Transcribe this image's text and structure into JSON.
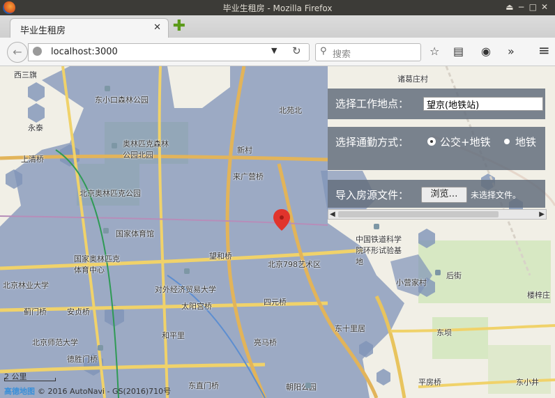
{
  "window": {
    "title": "毕业生租房 - Mozilla Firefox",
    "controls": [
      "⏏",
      "−",
      "□",
      "✕"
    ]
  },
  "tab": {
    "title": "毕业生租房",
    "close": "✕",
    "new_tab": "✚"
  },
  "nav": {
    "url": "localhost:3000",
    "search_placeholder": "搜索",
    "overflow": "»",
    "menu": "≡"
  },
  "panel": {
    "work_label": "选择工作地点：",
    "work_value": "望京(地铁站)",
    "commute_label": "选择通勤方式：",
    "option_bus_subway": "公交+地铁",
    "option_subway": "地铁",
    "selected_option": "公交+地铁",
    "import_label": "导入房源文件：",
    "browse_button": "浏览…",
    "no_file": "未选择文件。"
  },
  "map": {
    "labels": [
      {
        "text": "西三旗"
      },
      {
        "text": "东小口森林公园"
      },
      {
        "text": "北苑北"
      },
      {
        "text": "诸葛庄村"
      },
      {
        "text": "永泰"
      },
      {
        "text": "奥林匹克森林公园北园"
      },
      {
        "text": "新村"
      },
      {
        "text": "上清桥"
      },
      {
        "text": "来广营桥"
      },
      {
        "text": "北京奥林匹克公园"
      },
      {
        "text": "国家体育馆"
      },
      {
        "text": "望和桥"
      },
      {
        "text": "北京798艺术区"
      },
      {
        "text": "中国铁道科学院环形试验基地"
      },
      {
        "text": "国家奥林匹克体育中心"
      },
      {
        "text": "后街"
      },
      {
        "text": "北京林业大学"
      },
      {
        "text": "对外经济贸易大学"
      },
      {
        "text": "四元桥"
      },
      {
        "text": "小营家村"
      },
      {
        "text": "蓟门桥"
      },
      {
        "text": "太阳宫桥"
      },
      {
        "text": "楼梓庄"
      },
      {
        "text": "安贞桥"
      },
      {
        "text": "东坝"
      },
      {
        "text": "和平里"
      },
      {
        "text": "东十里居"
      },
      {
        "text": "北京师范大学"
      },
      {
        "text": "亮马桥"
      },
      {
        "text": "德胜门桥"
      },
      {
        "text": "东直门桥"
      },
      {
        "text": "朝阳公园"
      },
      {
        "text": "平房桥"
      },
      {
        "text": "东小井"
      }
    ],
    "scale": "2 公里",
    "copyright": "© 2016 AutoNavi - GS(2016)710号",
    "provider": "高德地图"
  },
  "colors": {
    "hex_fill": "#7f93b8",
    "panel_bg": "#646e7d",
    "marker": "#e1342c"
  }
}
